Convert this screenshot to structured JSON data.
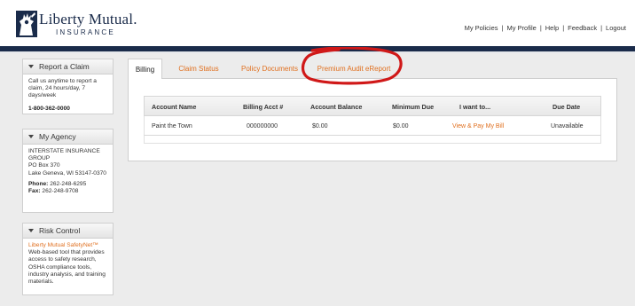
{
  "header": {
    "logo_name": "Liberty Mutual.",
    "logo_sub": "INSURANCE",
    "nav": [
      "My Policies",
      "My Profile",
      "Help",
      "Feedback",
      "Logout"
    ]
  },
  "sidebar": {
    "report_claim": {
      "title": "Report a Claim",
      "text": "Call us anytime to report a claim, 24 hours/day, 7 days/week",
      "phone": "1-800-362-0000"
    },
    "my_agency": {
      "title": "My Agency",
      "lines": [
        "INTERSTATE INSURANCE GROUP",
        "PO Box 370",
        "Lake Geneva, WI 53147-0370"
      ],
      "phone_label": "Phone:",
      "phone": "262-248-6295",
      "fax_label": "Fax:",
      "fax": "262-248-9708"
    },
    "risk_control": {
      "title": "Risk Control",
      "link": "Liberty Mutual SafetyNet™",
      "text": "Web-based tool that provides access to safety research, OSHA compliance tools, industry analysis, and training materials."
    }
  },
  "tabs": [
    "Billing",
    "Claim Status",
    "Policy Documents",
    "Premium Audit eReport"
  ],
  "table": {
    "headers": [
      "Account Name",
      "Billing Acct #",
      "Account Balance",
      "Minimum Due",
      "I want to...",
      "Due Date"
    ],
    "row": {
      "account_name": "Paint the Town",
      "billing_acct": "000000000",
      "balance": "$0.00",
      "minimum_due": "$0.00",
      "action": "View & Pay My Bill",
      "due_date": "Unavailable"
    }
  },
  "colors": {
    "brand_navy": "#1a2b4a",
    "link_orange": "#e07020",
    "annotation_red": "#d01818"
  }
}
